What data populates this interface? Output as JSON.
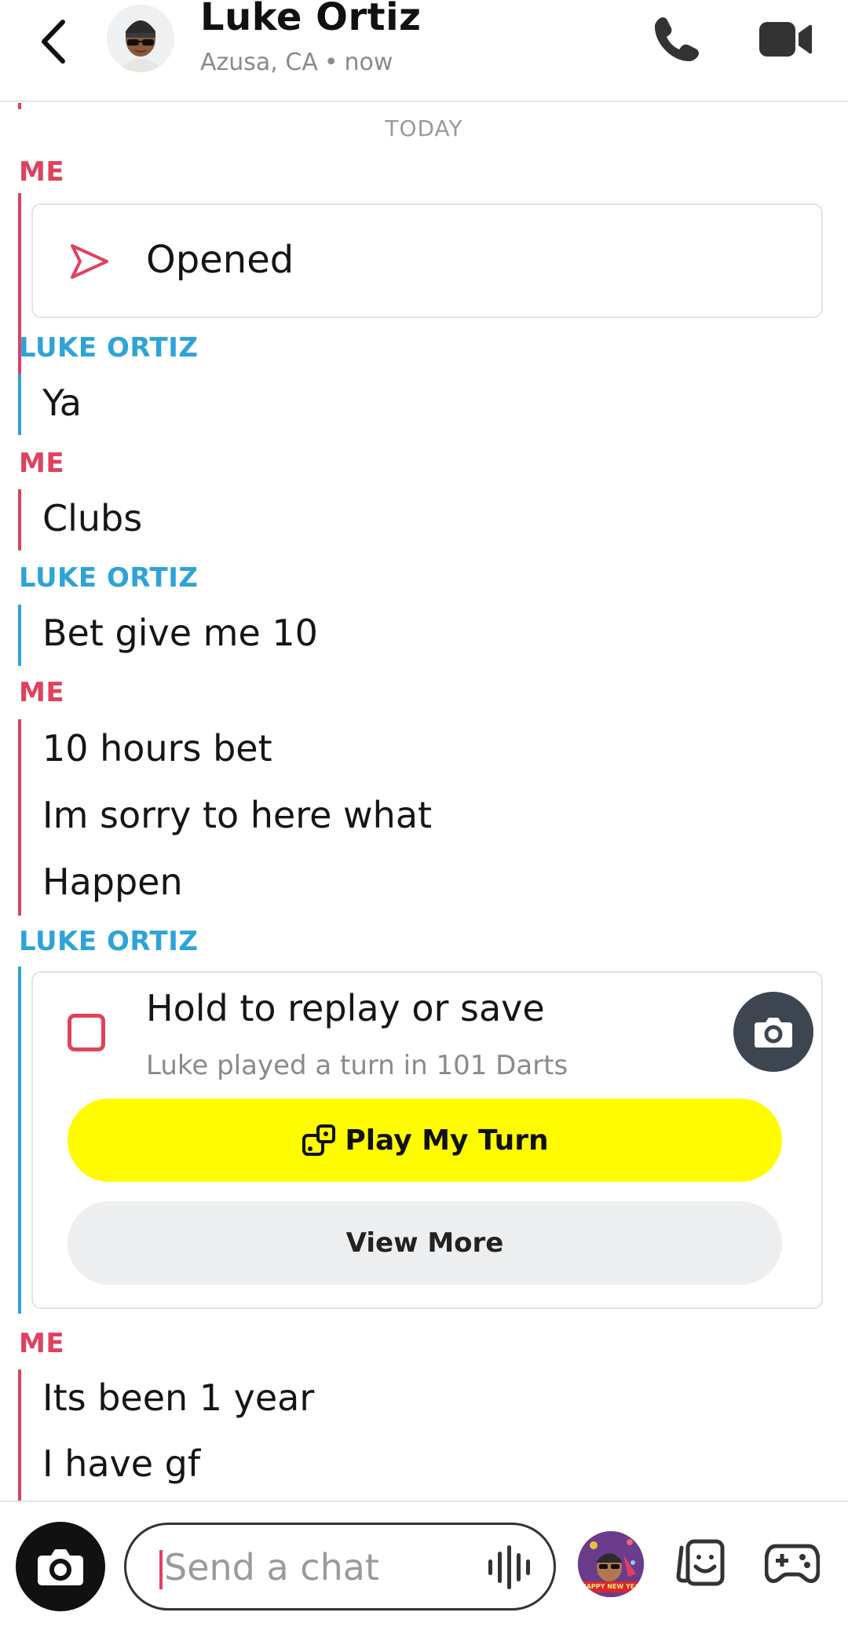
{
  "header": {
    "title": "Luke Ortiz",
    "location": "Azusa, CA",
    "dot": "•",
    "time": "now"
  },
  "chat": {
    "date_separator": "TODAY",
    "senders": {
      "me": "ME",
      "luke": "LUKE ORTIZ"
    },
    "opened_label": "Opened",
    "messages": {
      "ya": "Ya",
      "clubs": "Clubs",
      "bet": "Bet give me 10",
      "hours": "10 hours bet",
      "sorry": "Im sorry to here what",
      "happen": "Happen",
      "year": "Its been 1 year",
      "gf": "I have gf"
    },
    "game_card": {
      "title": "Hold to replay or save",
      "subtitle": "Luke played a turn in 101 Darts",
      "play_button": "Play My Turn",
      "more_button": "View More"
    }
  },
  "composer": {
    "placeholder": "Send a chat",
    "bitmoji_banner": "HAPPY NEW YEAR"
  },
  "colors": {
    "me": "#e0415d",
    "friend": "#2ea3d8",
    "play_button": "#fffc00",
    "camera_badge": "#3d4650"
  }
}
